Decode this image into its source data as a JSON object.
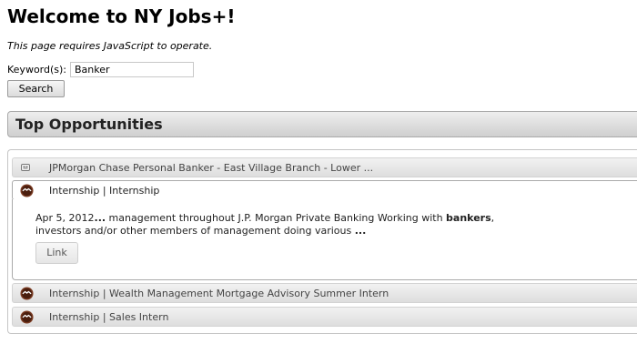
{
  "page": {
    "title": "Welcome to NY Jobs+!",
    "js_notice": "This page requires JavaScript to operate."
  },
  "search": {
    "keyword_label": "Keyword(s):",
    "keyword_value": "Banker",
    "button_label": "Search"
  },
  "section": {
    "title": "Top Opportunities"
  },
  "results": [
    {
      "label": "JPMorgan Chase Personal Banker - East Village Branch - Lower ...",
      "expanded": false,
      "icon": "collapsed-panel-icon"
    },
    {
      "label": "Internship | Internship",
      "expanded": true,
      "icon": "job-logo-icon",
      "snippet_date": "Apr 5, 2012",
      "snippet_ellipsis_1": "...",
      "snippet_text_1": " management throughout J.P. Morgan Private Banking Working with ",
      "snippet_keyword": "bankers",
      "snippet_text_2": ",",
      "snippet_text_3": "investors and/or other members of management doing various ",
      "snippet_ellipsis_2": "...",
      "link_label": "Link"
    },
    {
      "label": "Internship | Wealth Management Mortgage Advisory Summer Intern",
      "expanded": false,
      "icon": "job-logo-icon"
    },
    {
      "label": "Internship | Sales Intern",
      "expanded": false,
      "icon": "job-logo-icon"
    }
  ],
  "colors": {
    "header_gradient_top": "#eeeeee",
    "header_gradient_bottom": "#cfcfcf",
    "logo_icon": "#7a3b22"
  }
}
